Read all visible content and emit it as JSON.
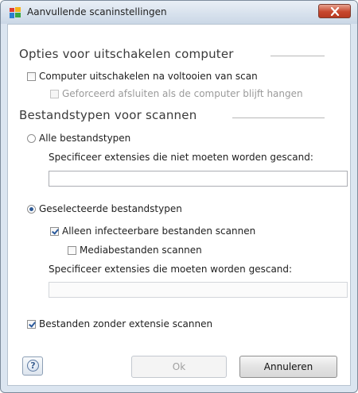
{
  "window": {
    "title": "Aanvullende scaninstellingen",
    "close_icon": "close-icon"
  },
  "shutdown_section": {
    "title": "Opties voor uitschakelen computer",
    "shutdown_after_scan": {
      "label": "Computer uitschakelen na voltooien van scan",
      "checked": false,
      "enabled": true
    },
    "force_close": {
      "label": "Geforceerd afsluiten als de computer blijft hangen",
      "checked": false,
      "enabled": false
    }
  },
  "filetypes_section": {
    "title": "Bestandstypen voor scannen",
    "all_types": {
      "label": "Alle bestandstypen",
      "selected": false
    },
    "exclude_label": "Specificeer extensies die niet moeten worden gescand:",
    "exclude_value": "",
    "selected_types": {
      "label": "Geselecteerde bestandstypen",
      "selected": true
    },
    "infectable_only": {
      "label": "Alleen infecteerbare bestanden scannen",
      "checked": true
    },
    "media_files": {
      "label": "Mediabestanden scannen",
      "checked": false
    },
    "include_label": "Specificeer extensies die moeten worden gescand:",
    "include_value": "",
    "no_extension": {
      "label": "Bestanden zonder extensie scannen",
      "checked": true
    }
  },
  "buttons": {
    "help_icon": "help-icon",
    "help_glyph": "?",
    "ok": "Ok",
    "cancel": "Annuleren"
  },
  "colors": {
    "window_frame": "#dbe5f0",
    "close_button": "#c7472e",
    "accent": "#2e5a95"
  }
}
